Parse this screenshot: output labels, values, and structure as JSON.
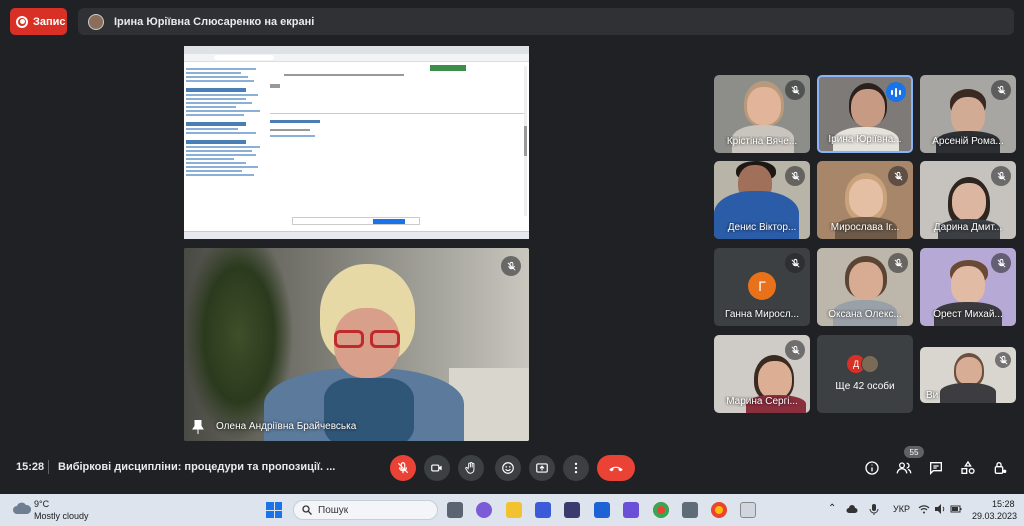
{
  "top_bar": {
    "record_label": "Запис",
    "presenting_text": "Ірина Юріївна Слюсаренко на екрані"
  },
  "presenter": {
    "name": "Олена Андріївна Брайчевська"
  },
  "participants": [
    {
      "name": "Крістіна Вяче..."
    },
    {
      "name": "Ірина Юріївна..."
    },
    {
      "name": "Арсеній Рома..."
    },
    {
      "name": "Денис Віктор..."
    },
    {
      "name": "Мирослава Іг..."
    },
    {
      "name": "Дарина Дмит..."
    },
    {
      "name": "Ганна Миросл...",
      "initial": "Г"
    },
    {
      "name": "Оксана Олекс..."
    },
    {
      "name": "Орест Михай..."
    },
    {
      "name": "Марина Сергі..."
    },
    {
      "name": "Ще 42 особи",
      "initial": "Д"
    },
    {
      "name": "Ви"
    }
  ],
  "meeting": {
    "time": "15:28",
    "title": "Вибіркові дисципліни: процедури та пропозиції. ...",
    "participant_count": "55"
  },
  "taskbar": {
    "temperature": "9°C",
    "weather": "Mostly cloudy",
    "search_placeholder": "Пошук",
    "language": "УКР",
    "time": "15:28",
    "date": "29.03.2023"
  },
  "colors": {
    "background": "#202124",
    "record": "#d93025",
    "end_call": "#ea4335",
    "speaking": "#1a73e8"
  }
}
